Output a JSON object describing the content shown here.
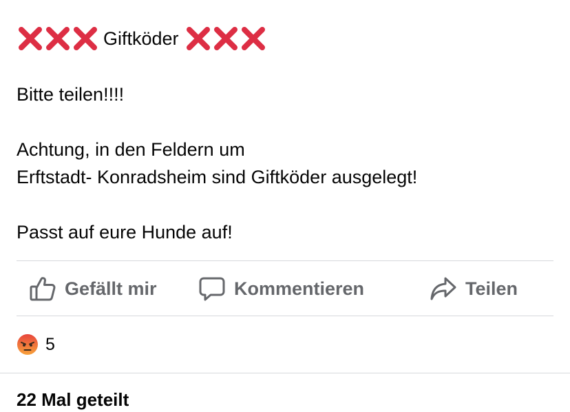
{
  "post": {
    "title_left_marks": "❌❌❌",
    "title": "Giftköder",
    "title_right_marks": "❌❌❌",
    "lines": [
      "Bitte teilen!!!!",
      "Achtung, in den Feldern um",
      "Erftstadt- Konradsheim sind Giftköder ausgelegt!",
      "Passt auf eure Hunde auf!"
    ]
  },
  "actions": {
    "like_label": "Gefällt mir",
    "like_icon": "thumbs-up-icon",
    "comment_label": "Kommentieren",
    "comment_icon": "speech-bubble-icon",
    "share_label": "Teilen",
    "share_icon": "share-arrow-icon"
  },
  "reactions": {
    "icon": "angry-face-icon",
    "count": "5"
  },
  "shares": {
    "label": "22 Mal geteilt"
  },
  "colors": {
    "cross_red": "#dd2e44",
    "action_gray": "#65676b",
    "divider": "#d6d8dc",
    "angry_orange": "#f0703a"
  }
}
